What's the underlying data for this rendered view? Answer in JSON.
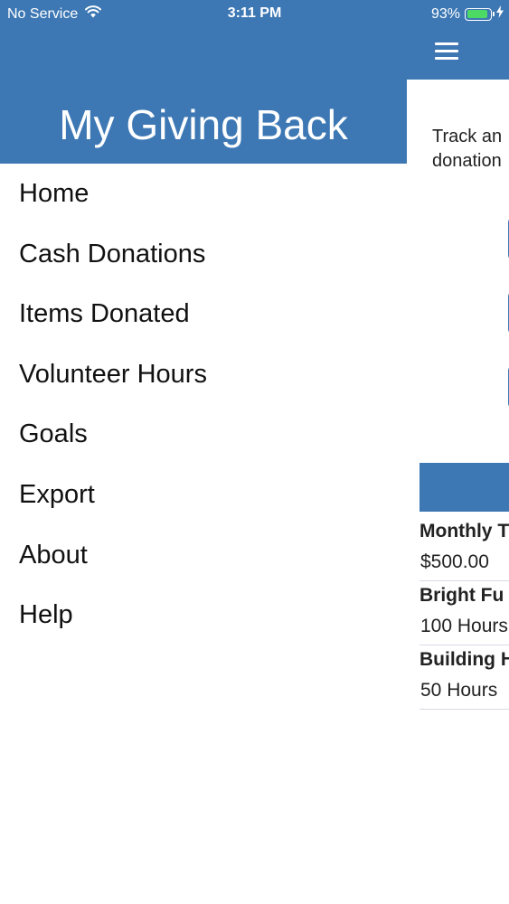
{
  "status_bar": {
    "carrier": "No Service",
    "time": "3:11 PM",
    "battery_percent": "93%",
    "battery_level": 0.93
  },
  "drawer": {
    "title": "My Giving Back",
    "menu_items": [
      {
        "label": "Home"
      },
      {
        "label": "Cash Donations"
      },
      {
        "label": "Items Donated"
      },
      {
        "label": "Volunteer Hours"
      },
      {
        "label": "Goals"
      },
      {
        "label": "Export"
      },
      {
        "label": "About"
      },
      {
        "label": "Help"
      }
    ]
  },
  "main": {
    "intro_text_line1": "Track an",
    "intro_text_line2": "donation",
    "goals": [
      {
        "title": "Monthly T",
        "value": "$500.00"
      },
      {
        "title": "Bright Fu",
        "value": "100 Hours"
      },
      {
        "title": "Building H",
        "value": "50 Hours"
      }
    ]
  },
  "colors": {
    "brand_blue": "#3d78b4",
    "battery_green": "#4cd964"
  },
  "icons": {
    "menu": "hamburger-icon",
    "wifi": "wifi-icon",
    "battery": "battery-icon",
    "charging": "charging-bolt-icon"
  }
}
